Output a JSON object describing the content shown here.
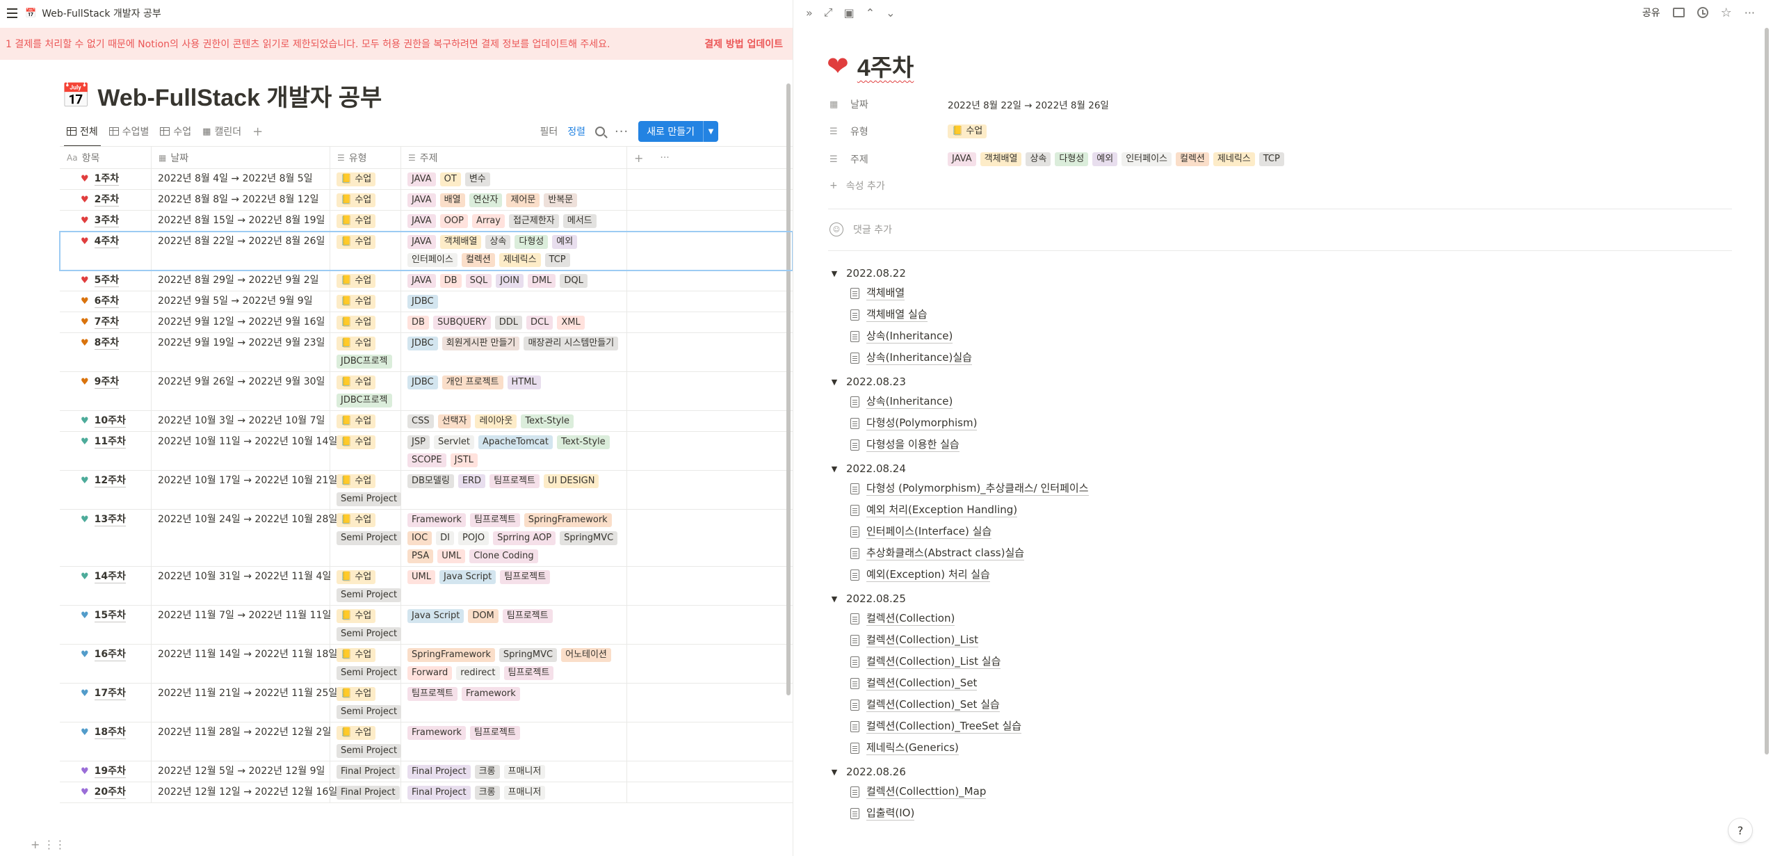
{
  "breadcrumb": {
    "icon": "calendar-icon",
    "title": "Web-FullStack 개발자 공부"
  },
  "banner": {
    "text": "1 결제를 처리할 수 없기 때문에 Notion의 사용 권한이 콘텐츠 읽기로 제한되었습니다. 모두 허용 권한을 복구하려면 결제 정보를 업데이트해 주세요.",
    "button": "결제 방법 업데이트"
  },
  "page": {
    "emoji": "📅",
    "title": "Web-FullStack 개발자 공부"
  },
  "views": [
    {
      "label": "전체",
      "icon": "table-icon",
      "active": true
    },
    {
      "label": "수업별",
      "icon": "table-icon",
      "active": false
    },
    {
      "label": "수업",
      "icon": "table-icon",
      "active": false
    },
    {
      "label": "캘린더",
      "icon": "calendar-icon",
      "active": false
    }
  ],
  "toolbar": {
    "filter": "필터",
    "sort": "정렬",
    "new": "새로 만들기"
  },
  "columns": {
    "name": "항목",
    "date": "날짜",
    "type": "유형",
    "topic": "주제"
  },
  "colors": {
    "red": "#e03e3e",
    "orange": "#d9730d",
    "green": "#4dab9a",
    "blue": "#529cca",
    "purple": "#9a6dd7",
    "accent": "#2383e2",
    "banner_bg": "#fde9e6",
    "banner_text": "#eb5757"
  },
  "rows": [
    {
      "heart": "red",
      "name": "1주차",
      "date": "2022년 8월 4일 → 2022년 8월 5일",
      "types": [
        [
          "📒 수업",
          "sugup"
        ]
      ],
      "tags": [
        [
          "JAVA",
          "pink"
        ],
        [
          "OT",
          "yellow"
        ],
        [
          "변수",
          "gray"
        ]
      ]
    },
    {
      "heart": "red",
      "name": "2주차",
      "date": "2022년 8월 8일 → 2022년 8월 12일",
      "types": [
        [
          "📒 수업",
          "sugup"
        ]
      ],
      "tags": [
        [
          "JAVA",
          "pink"
        ],
        [
          "배열",
          "orange"
        ],
        [
          "연산자",
          "green"
        ],
        [
          "제어문",
          "orange"
        ],
        [
          "반복문",
          "brown"
        ]
      ]
    },
    {
      "heart": "red",
      "name": "3주차",
      "date": "2022년 8월 15일 → 2022년 8월 19일",
      "types": [
        [
          "📒 수업",
          "sugup"
        ]
      ],
      "tags": [
        [
          "JAVA",
          "pink"
        ],
        [
          "OOP",
          "red"
        ],
        [
          "Array",
          "red"
        ],
        [
          "접근제한자",
          "gray"
        ],
        [
          "메서드",
          "gray"
        ]
      ]
    },
    {
      "heart": "red",
      "name": "4주차",
      "date": "2022년 8월 22일 → 2022년 8월 26일",
      "types": [
        [
          "📒 수업",
          "sugup"
        ]
      ],
      "tags": [
        [
          "JAVA",
          "pink"
        ],
        [
          "객체배열",
          "yellow"
        ],
        [
          "상속",
          "gray"
        ],
        [
          "다형성",
          "green"
        ],
        [
          "예외",
          "purple"
        ],
        [
          "인터페이스",
          "default"
        ],
        [
          "컬렉션",
          "orange"
        ],
        [
          "제네릭스",
          "yellow"
        ],
        [
          "TCP",
          "gray"
        ]
      ],
      "selected": true
    },
    {
      "heart": "red",
      "name": "5주차",
      "date": "2022년 8월 29일 → 2022년 9월 2일",
      "types": [
        [
          "📒 수업",
          "sugup"
        ]
      ],
      "tags": [
        [
          "JAVA",
          "pink"
        ],
        [
          "DB",
          "red"
        ],
        [
          "SQL",
          "pink"
        ],
        [
          "JOIN",
          "purple"
        ],
        [
          "DML",
          "pink"
        ],
        [
          "DQL",
          "gray"
        ]
      ]
    },
    {
      "heart": "orange",
      "name": "6주차",
      "date": "2022년 9월 5일 → 2022년 9월 9일",
      "types": [
        [
          "📒 수업",
          "sugup"
        ]
      ],
      "tags": [
        [
          "JDBC",
          "blue"
        ]
      ]
    },
    {
      "heart": "orange",
      "name": "7주차",
      "date": "2022년 9월 12일 → 2022년 9월 16일",
      "types": [
        [
          "📒 수업",
          "sugup"
        ]
      ],
      "tags": [
        [
          "DB",
          "red"
        ],
        [
          "SUBQUERY",
          "pink"
        ],
        [
          "DDL",
          "gray"
        ],
        [
          "DCL",
          "pink"
        ],
        [
          "XML",
          "red"
        ]
      ]
    },
    {
      "heart": "orange",
      "name": "8주차",
      "date": "2022년 9월 19일 → 2022년 9월 23일",
      "types": [
        [
          "📒 수업",
          "sugup"
        ],
        [
          "JDBC프로젝",
          "jdbcp"
        ]
      ],
      "tags": [
        [
          "JDBC",
          "blue"
        ],
        [
          "회원게시판 만들기",
          "brown"
        ],
        [
          "매장관리 시스템만들기",
          "gray"
        ]
      ]
    },
    {
      "heart": "orange",
      "name": "9주차",
      "date": "2022년 9월 26일 → 2022년 9월 30일",
      "types": [
        [
          "📒 수업",
          "sugup"
        ],
        [
          "JDBC프로젝",
          "jdbcp"
        ]
      ],
      "tags": [
        [
          "JDBC",
          "blue"
        ],
        [
          "개인 프로젝트",
          "orange"
        ],
        [
          "HTML",
          "purple"
        ]
      ]
    },
    {
      "heart": "green",
      "name": "10주차",
      "date": "2022년 10월 3일 → 2022년 10월 7일",
      "types": [
        [
          "📒 수업",
          "sugup"
        ]
      ],
      "tags": [
        [
          "CSS",
          "gray"
        ],
        [
          "선택자",
          "orange"
        ],
        [
          "레이아웃",
          "yellow"
        ],
        [
          "Text-Style",
          "green"
        ]
      ]
    },
    {
      "heart": "green",
      "name": "11주차",
      "date": "2022년 10월 11일 → 2022년 10월 14일",
      "types": [
        [
          "📒 수업",
          "sugup"
        ]
      ],
      "tags": [
        [
          "JSP",
          "gray"
        ],
        [
          "Servlet",
          "default"
        ],
        [
          "ApacheTomcat",
          "blue"
        ],
        [
          "Text-Style",
          "green"
        ],
        [
          "SCOPE",
          "pink"
        ],
        [
          "JSTL",
          "red"
        ]
      ]
    },
    {
      "heart": "green",
      "name": "12주차",
      "date": "2022년 10월 17일 → 2022년 10월 21일",
      "types": [
        [
          "📒 수업",
          "sugup"
        ],
        [
          "Semi Project",
          "semi"
        ]
      ],
      "tags": [
        [
          "DB모델링",
          "gray"
        ],
        [
          "ERD",
          "purple"
        ],
        [
          "팀프로젝트",
          "pink"
        ],
        [
          "UI DESIGN",
          "yellow"
        ]
      ]
    },
    {
      "heart": "green",
      "name": "13주차",
      "date": "2022년 10월 24일 → 2022년 10월 28일",
      "types": [
        [
          "📒 수업",
          "sugup"
        ],
        [
          "Semi Project",
          "semi"
        ]
      ],
      "tags": [
        [
          "Framework",
          "pink"
        ],
        [
          "팀프로젝트",
          "pink"
        ],
        [
          "SpringFramework",
          "orange"
        ],
        [
          "IOC",
          "orange"
        ],
        [
          "DI",
          "default"
        ],
        [
          "POJO",
          "default"
        ],
        [
          "Sprring AOP",
          "pink"
        ],
        [
          "SpringMVC",
          "gray"
        ],
        [
          "PSA",
          "orange"
        ],
        [
          "UML",
          "red"
        ],
        [
          "Clone Coding",
          "pink"
        ]
      ]
    },
    {
      "heart": "green",
      "name": "14주차",
      "date": "2022년 10월 31일 → 2022년 11월 4일",
      "types": [
        [
          "📒 수업",
          "sugup"
        ],
        [
          "Semi Project",
          "semi"
        ]
      ],
      "tags": [
        [
          "UML",
          "red"
        ],
        [
          "Java Script",
          "blue"
        ],
        [
          "팀프로젝트",
          "pink"
        ]
      ]
    },
    {
      "heart": "blue",
      "name": "15주차",
      "date": "2022년 11월 7일 → 2022년 11월 11일",
      "types": [
        [
          "📒 수업",
          "sugup"
        ],
        [
          "Semi Project",
          "semi"
        ]
      ],
      "tags": [
        [
          "Java Script",
          "blue"
        ],
        [
          "DOM",
          "orange"
        ],
        [
          "팀프로젝트",
          "pink"
        ]
      ]
    },
    {
      "heart": "blue",
      "name": "16주차",
      "date": "2022년 11월 14일 → 2022년 11월 18일",
      "types": [
        [
          "📒 수업",
          "sugup"
        ],
        [
          "Semi Project",
          "semi"
        ]
      ],
      "tags": [
        [
          "SpringFramework",
          "orange"
        ],
        [
          "SpringMVC",
          "gray"
        ],
        [
          "어노테이션",
          "orange"
        ],
        [
          "Forward",
          "red"
        ],
        [
          "redirect",
          "default"
        ],
        [
          "팀프로젝트",
          "pink"
        ]
      ]
    },
    {
      "heart": "blue",
      "name": "17주차",
      "date": "2022년 11월 21일 → 2022년 11월 25일",
      "types": [
        [
          "📒 수업",
          "sugup"
        ],
        [
          "Semi Project",
          "semi"
        ]
      ],
      "tags": [
        [
          "팀프로젝트",
          "pink"
        ],
        [
          "Framework",
          "pink"
        ]
      ]
    },
    {
      "heart": "blue",
      "name": "18주차",
      "date": "2022년 11월 28일 → 2022년 12월 2일",
      "types": [
        [
          "📒 수업",
          "sugup"
        ],
        [
          "Semi Project",
          "semi"
        ]
      ],
      "tags": [
        [
          "Framework",
          "pink"
        ],
        [
          "팀프로젝트",
          "pink"
        ]
      ]
    },
    {
      "heart": "purple",
      "name": "19주차",
      "date": "2022년 12월 5일 → 2022년 12월 9일",
      "types": [
        [
          "Final Project",
          "final"
        ]
      ],
      "tags": [
        [
          "Final Project",
          "purple"
        ],
        [
          "크롱",
          "gray"
        ],
        [
          "프매니저",
          "default"
        ]
      ]
    },
    {
      "heart": "purple",
      "name": "20주차",
      "date": "2022년 12월 12일 → 2022년 12월 16일",
      "types": [
        [
          "Final Project",
          "final"
        ]
      ],
      "tags": [
        [
          "Final Project",
          "purple"
        ],
        [
          "크롱",
          "gray"
        ],
        [
          "프매니저",
          "default"
        ]
      ]
    }
  ],
  "right": {
    "toolbar": {
      "share": "공유"
    },
    "title": {
      "emoji": "❤️",
      "text": "4주차"
    },
    "props": {
      "date_label": "날짜",
      "date_value": "2022년 8월 22일 → 2022년 8월 26일",
      "type_label": "유형",
      "type_value": "📒 수업",
      "topic_label": "주제",
      "add_prop": "속성 추가"
    },
    "comment": "댓글 추가",
    "toggles": [
      {
        "date": "2022.08.22",
        "pages": [
          "객체배열",
          "객체배열 실습",
          "상속(Inheritance)",
          "상속(Inheritance)실습"
        ]
      },
      {
        "date": "2022.08.23",
        "pages": [
          "상속(Inheritance)",
          "다형성(Polymorphism)",
          "다형성을 이용한 실습"
        ]
      },
      {
        "date": "2022.08.24",
        "pages": [
          "다형성 (Polymorphism)_추상클래스/ 인터페이스",
          "예외 처리(Exception Handling)",
          "인터페이스(Interface) 실습",
          "추상화클래스(Abstract class)실습",
          "예외(Exception) 처리 실습"
        ]
      },
      {
        "date": "2022.08.25",
        "pages": [
          "컬렉션(Collection)",
          "컬렉션(Collection)_List",
          "컬렉션(Collection)_List 실습",
          "컬렉션(Collection)_Set",
          "컬렉션(Collection)_Set 실습",
          "컬렉션(Collection)_TreeSet 실습",
          "제네릭스(Generics)"
        ]
      },
      {
        "date": "2022.08.26",
        "pages": [
          "컬렉션(Collecttion)_Map",
          "입출력(IO)"
        ]
      }
    ],
    "help": "?"
  }
}
